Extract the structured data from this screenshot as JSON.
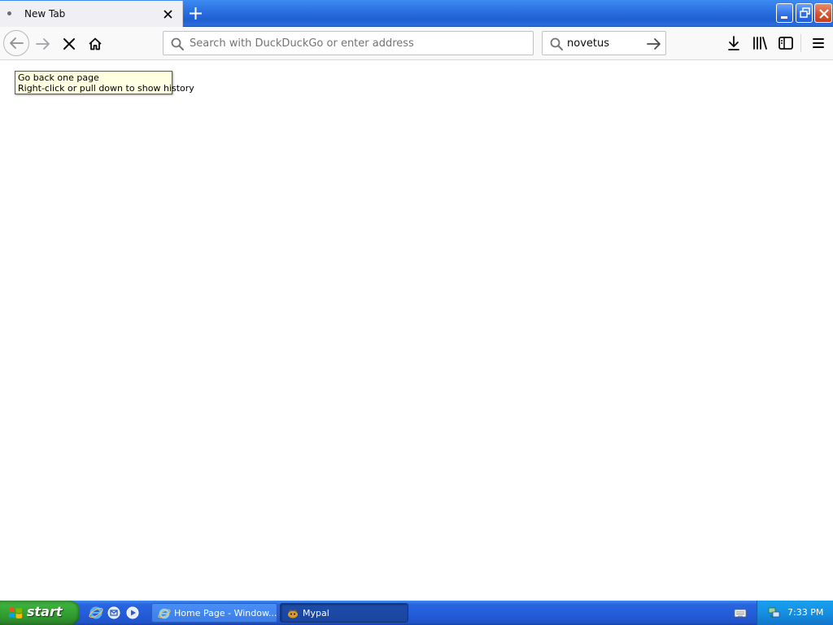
{
  "tab": {
    "title": "New Tab"
  },
  "urlbar": {
    "placeholder": "Search with DuckDuckGo or enter address",
    "value": ""
  },
  "searchbar": {
    "value": "novetus"
  },
  "tooltip": {
    "line1": "Go back one page",
    "line2": "Right-click or pull down to show history"
  },
  "taskbar": {
    "start_label": "start",
    "tasks": [
      {
        "label": "Home Page - Window..."
      },
      {
        "label": "Mypal"
      }
    ],
    "clock": "7:33 PM"
  },
  "colors": {
    "taskbar_blue": "#245edb",
    "start_green": "#3bb13b",
    "tooltip_bg": "#ffffe1",
    "close_red": "#d3522f"
  },
  "icons": [
    "back-arrow-icon",
    "forward-arrow-icon",
    "stop-icon",
    "home-icon",
    "search-icon",
    "go-arrow-icon",
    "download-icon",
    "library-icon",
    "sidebar-icon",
    "hamburger-menu-icon"
  ]
}
